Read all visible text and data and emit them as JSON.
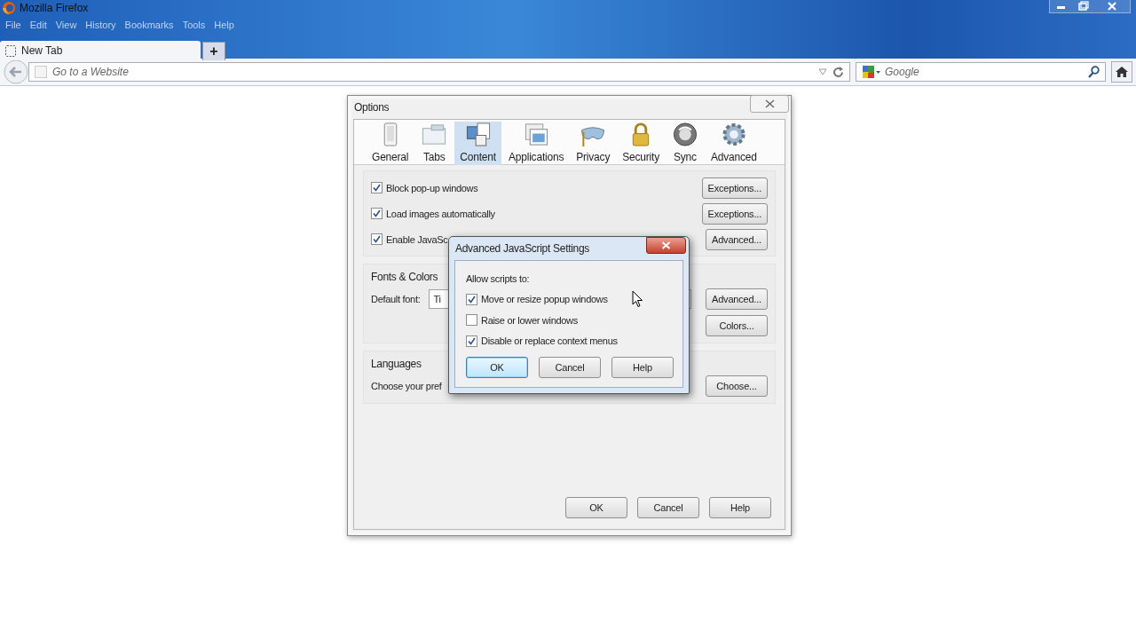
{
  "browser": {
    "title": "Mozilla Firefox",
    "menu": [
      "File",
      "Edit",
      "View",
      "History",
      "Bookmarks",
      "Tools",
      "Help"
    ],
    "tabs": [
      {
        "label": "New Tab",
        "selected": true
      }
    ],
    "new_tab_button": "+",
    "address": {
      "placeholder": "Go to a Website"
    },
    "search": {
      "placeholder": "Google"
    }
  },
  "options_dialog": {
    "title": "Options",
    "panes": [
      {
        "label": "General",
        "selected": false
      },
      {
        "label": "Tabs",
        "selected": false
      },
      {
        "label": "Content",
        "selected": true
      },
      {
        "label": "Applications",
        "selected": false
      },
      {
        "label": "Privacy",
        "selected": false
      },
      {
        "label": "Security",
        "selected": false
      },
      {
        "label": "Sync",
        "selected": false
      },
      {
        "label": "Advanced",
        "selected": false
      }
    ],
    "content_rows": [
      {
        "label": "Block pop-up windows",
        "checked": true,
        "button": "Exceptions..."
      },
      {
        "label": "Load images automatically",
        "checked": true,
        "button": "Exceptions..."
      },
      {
        "label": "Enable JavaSc",
        "checked": true,
        "button": "Advanced..."
      }
    ],
    "fonts_colors": {
      "heading": "Fonts & Colors",
      "font_label": "Default font:",
      "font_value": "Ti",
      "buttons": [
        "Advanced...",
        "Colors..."
      ]
    },
    "languages": {
      "heading": "Languages",
      "text": "Choose your pref",
      "button": "Choose..."
    },
    "buttons": [
      "OK",
      "Cancel",
      "Help"
    ]
  },
  "js_dialog": {
    "title": "Advanced JavaScript Settings",
    "heading": "Allow scripts to:",
    "options": [
      {
        "label": "Move or resize popup windows",
        "checked": true
      },
      {
        "label": "Raise or lower windows",
        "checked": false
      },
      {
        "label": "Disable or replace context menus",
        "checked": true
      }
    ],
    "buttons": [
      {
        "label": "OK",
        "default": true
      },
      {
        "label": "Cancel",
        "default": false
      },
      {
        "label": "Help",
        "default": false
      }
    ]
  }
}
